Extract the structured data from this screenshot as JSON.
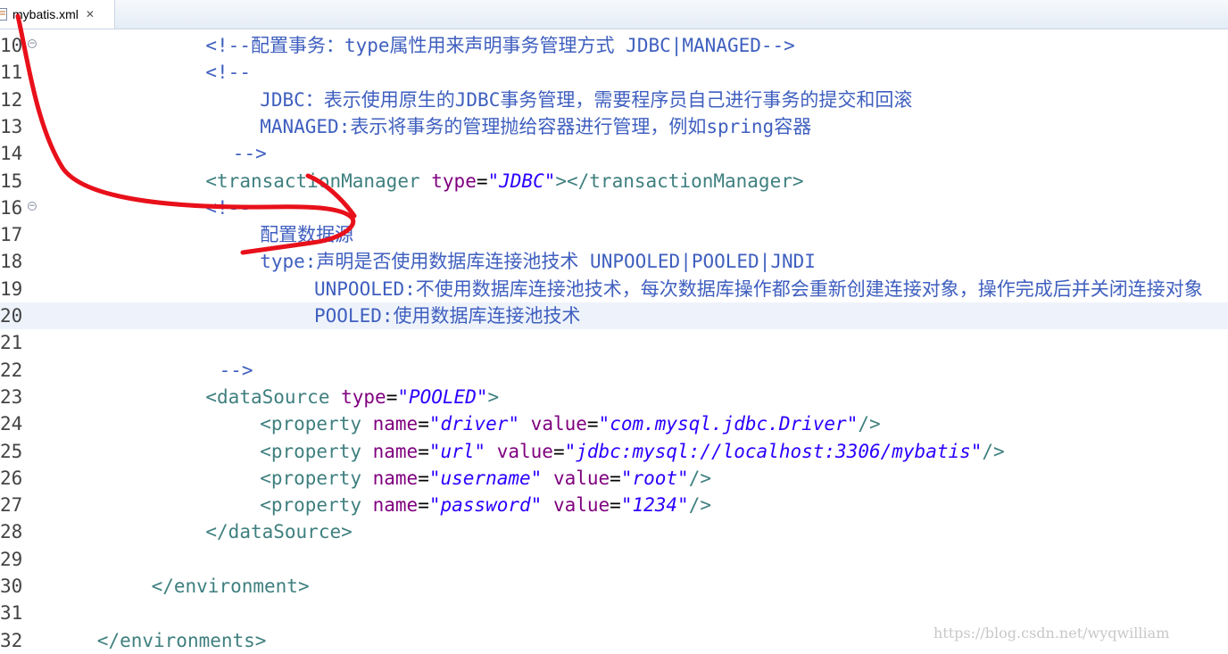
{
  "tab": {
    "label": "mybatis.xml",
    "close": "✕"
  },
  "lines": [
    {
      "n": "10",
      "fold": true,
      "indent": 12,
      "segs": [
        {
          "t": "<!--配置事务：type属性用来声明事务管理方式 JDBC|MANAGED-->",
          "c": "cm"
        }
      ]
    },
    {
      "n": "11",
      "fold": false,
      "indent": 12,
      "segs": [
        {
          "t": "<!--",
          "c": "cm"
        }
      ]
    },
    {
      "n": "12",
      "fold": false,
      "indent": 16,
      "segs": [
        {
          "t": "JDBC：表示使用原生的JDBC事务管理，需要程序员自己进行事务的提交和回滚",
          "c": "cm"
        }
      ]
    },
    {
      "n": "13",
      "fold": false,
      "indent": 16,
      "segs": [
        {
          "t": "MANAGED:表示将事务的管理抛给容器进行管理，例如spring容器",
          "c": "cm"
        }
      ]
    },
    {
      "n": "14",
      "fold": false,
      "indent": 14,
      "segs": [
        {
          "t": "-->",
          "c": "cm"
        }
      ]
    },
    {
      "n": "15",
      "fold": false,
      "indent": 12,
      "segs": [
        {
          "t": "<transactionManager ",
          "c": "tg"
        },
        {
          "t": "type",
          "c": "an"
        },
        {
          "t": "=",
          "c": ""
        },
        {
          "t": "\"JDBC\"",
          "c": "av"
        },
        {
          "t": "></transactionManager>",
          "c": "tg"
        }
      ]
    },
    {
      "n": "16",
      "fold": true,
      "indent": 12,
      "segs": [
        {
          "t": "<!--",
          "c": "cm"
        }
      ]
    },
    {
      "n": "17",
      "fold": false,
      "indent": 16,
      "segs": [
        {
          "t": "配置数据源",
          "c": "cm"
        }
      ]
    },
    {
      "n": "18",
      "fold": false,
      "indent": 16,
      "segs": [
        {
          "t": "type:声明是否使用数据库连接池技术 UNPOOLED|POOLED|JNDI",
          "c": "cm"
        }
      ]
    },
    {
      "n": "19",
      "fold": false,
      "indent": 20,
      "segs": [
        {
          "t": "UNPOOLED:不使用数据库连接池技术，每次数据库操作都会重新创建连接对象，操作完成后并关闭连接对象",
          "c": "cm"
        }
      ]
    },
    {
      "n": "20",
      "fold": false,
      "indent": 20,
      "cur": true,
      "segs": [
        {
          "t": "POOLED:使用数据库连接池技术",
          "c": "cm"
        }
      ]
    },
    {
      "n": "21",
      "fold": false,
      "indent": 0,
      "segs": []
    },
    {
      "n": "22",
      "fold": false,
      "indent": 13,
      "segs": [
        {
          "t": "-->",
          "c": "cm"
        }
      ]
    },
    {
      "n": "23",
      "fold": false,
      "indent": 12,
      "segs": [
        {
          "t": "<dataSource ",
          "c": "tg"
        },
        {
          "t": "type",
          "c": "an"
        },
        {
          "t": "=",
          "c": ""
        },
        {
          "t": "\"POOLED\"",
          "c": "av"
        },
        {
          "t": ">",
          "c": "tg"
        }
      ]
    },
    {
      "n": "24",
      "fold": false,
      "indent": 16,
      "segs": [
        {
          "t": "<property ",
          "c": "tg"
        },
        {
          "t": "name",
          "c": "an"
        },
        {
          "t": "=",
          "c": ""
        },
        {
          "t": "\"driver\"",
          "c": "av"
        },
        {
          "t": " ",
          "c": ""
        },
        {
          "t": "value",
          "c": "an"
        },
        {
          "t": "=",
          "c": ""
        },
        {
          "t": "\"com.mysql.jdbc.Driver\"",
          "c": "av"
        },
        {
          "t": "/>",
          "c": "tg"
        }
      ]
    },
    {
      "n": "25",
      "fold": false,
      "indent": 16,
      "segs": [
        {
          "t": "<property ",
          "c": "tg"
        },
        {
          "t": "name",
          "c": "an"
        },
        {
          "t": "=",
          "c": ""
        },
        {
          "t": "\"url\"",
          "c": "av"
        },
        {
          "t": " ",
          "c": ""
        },
        {
          "t": "value",
          "c": "an"
        },
        {
          "t": "=",
          "c": ""
        },
        {
          "t": "\"jdbc:mysql://localhost:3306/mybatis\"",
          "c": "av"
        },
        {
          "t": "/>",
          "c": "tg"
        }
      ]
    },
    {
      "n": "26",
      "fold": false,
      "indent": 16,
      "segs": [
        {
          "t": "<property ",
          "c": "tg"
        },
        {
          "t": "name",
          "c": "an"
        },
        {
          "t": "=",
          "c": ""
        },
        {
          "t": "\"username\"",
          "c": "av"
        },
        {
          "t": " ",
          "c": ""
        },
        {
          "t": "value",
          "c": "an"
        },
        {
          "t": "=",
          "c": ""
        },
        {
          "t": "\"root\"",
          "c": "av"
        },
        {
          "t": "/>",
          "c": "tg"
        }
      ]
    },
    {
      "n": "27",
      "fold": false,
      "indent": 16,
      "segs": [
        {
          "t": "<property ",
          "c": "tg"
        },
        {
          "t": "name",
          "c": "an"
        },
        {
          "t": "=",
          "c": ""
        },
        {
          "t": "\"password\"",
          "c": "av"
        },
        {
          "t": " ",
          "c": ""
        },
        {
          "t": "value",
          "c": "an"
        },
        {
          "t": "=",
          "c": ""
        },
        {
          "t": "\"1234\"",
          "c": "av"
        },
        {
          "t": "/>",
          "c": "tg"
        }
      ]
    },
    {
      "n": "28",
      "fold": false,
      "indent": 12,
      "segs": [
        {
          "t": "</dataSource>",
          "c": "tg"
        }
      ]
    },
    {
      "n": "29",
      "fold": false,
      "indent": 0,
      "segs": []
    },
    {
      "n": "30",
      "fold": false,
      "indent": 8,
      "segs": [
        {
          "t": "</environment>",
          "c": "tg"
        }
      ]
    },
    {
      "n": "31",
      "fold": false,
      "indent": 0,
      "segs": []
    },
    {
      "n": "32",
      "fold": false,
      "indent": 4,
      "segs": [
        {
          "t": "</environments>",
          "c": "tg"
        }
      ]
    }
  ],
  "watermark": "https://blog.csdn.net/wyqwilliam",
  "colors": {
    "comment": "#3f5fbf",
    "tag": "#3f7f7f",
    "attr_name": "#7f007f",
    "attr_value": "#2a00ff",
    "annotation": "#e8101a"
  }
}
